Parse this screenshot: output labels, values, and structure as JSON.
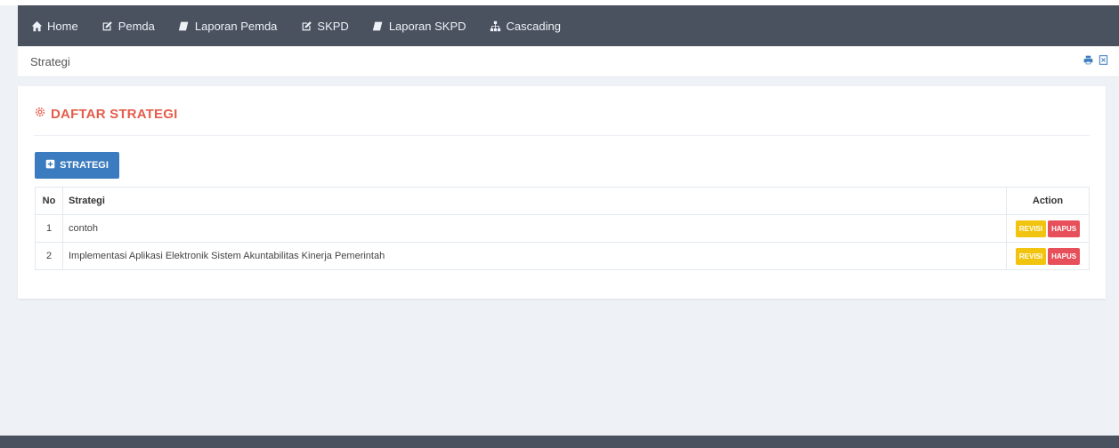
{
  "nav": {
    "items": [
      {
        "label": "Home",
        "icon": "home-icon"
      },
      {
        "label": "Pemda",
        "icon": "edit-icon"
      },
      {
        "label": "Laporan Pemda",
        "icon": "book-icon"
      },
      {
        "label": "SKPD",
        "icon": "edit-icon"
      },
      {
        "label": "Laporan SKPD",
        "icon": "book-icon"
      },
      {
        "label": "Cascading",
        "icon": "sitemap-icon"
      }
    ]
  },
  "breadcrumb": {
    "label": "Strategi"
  },
  "tools": {
    "print_icon": "print-icon",
    "export_icon": "excel-icon"
  },
  "panel": {
    "title": "DAFTAR STRATEGI",
    "title_icon": "gear-icon",
    "add_button": "STRATEGI"
  },
  "table": {
    "headers": {
      "no": "No",
      "strategi": "Strategi",
      "action": "Action"
    },
    "rows": [
      {
        "no": "1",
        "strategi": "contoh",
        "revisi": "REVISI",
        "hapus": "HAPUS"
      },
      {
        "no": "2",
        "strategi": "Implementasi Aplikasi Elektronik Sistem Akuntabilitas Kinerja Pemerintah",
        "revisi": "REVISI",
        "hapus": "HAPUS"
      }
    ]
  },
  "colors": {
    "navbar": "#4a5260",
    "title": "#e45d4b",
    "primary": "#3b7bbf",
    "warning": "#f1c40f",
    "danger": "#e7505a"
  }
}
